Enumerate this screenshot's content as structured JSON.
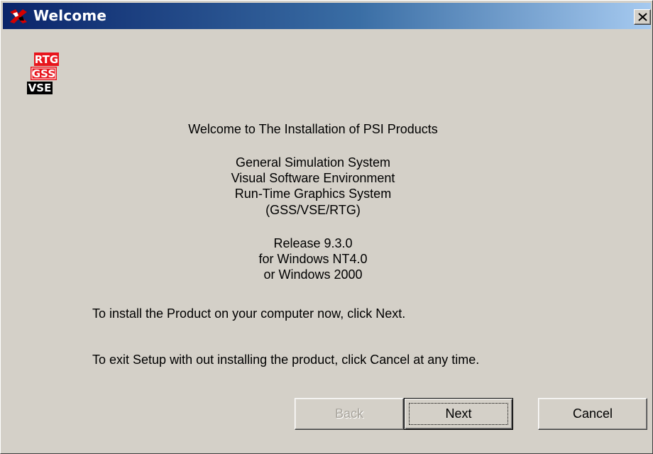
{
  "window": {
    "title": "Welcome"
  },
  "logo": {
    "lines": [
      "RTG",
      "GSS",
      "VSE"
    ]
  },
  "content": {
    "welcome_line": "Welcome to The Installation of PSI Products",
    "product_lines": [
      "General Simulation System",
      "Visual Software Environment",
      "Run-Time Graphics System",
      "(GSS/VSE/RTG)"
    ],
    "release_lines": [
      "Release 9.3.0",
      "for Windows NT4.0",
      "or Windows 2000"
    ],
    "install_instruction": "To install the Product on your computer now, click Next.",
    "exit_instruction": "To exit Setup with out installing the product, click Cancel at any time."
  },
  "buttons": {
    "back": "Back",
    "next": "Next",
    "cancel": "Cancel"
  },
  "colors": {
    "title_gradient_start": "#0a246a",
    "title_gradient_end": "#a6caf0",
    "window_face": "#d4d0c8",
    "logo_red": "#e8141c",
    "logo_black": "#000000"
  }
}
